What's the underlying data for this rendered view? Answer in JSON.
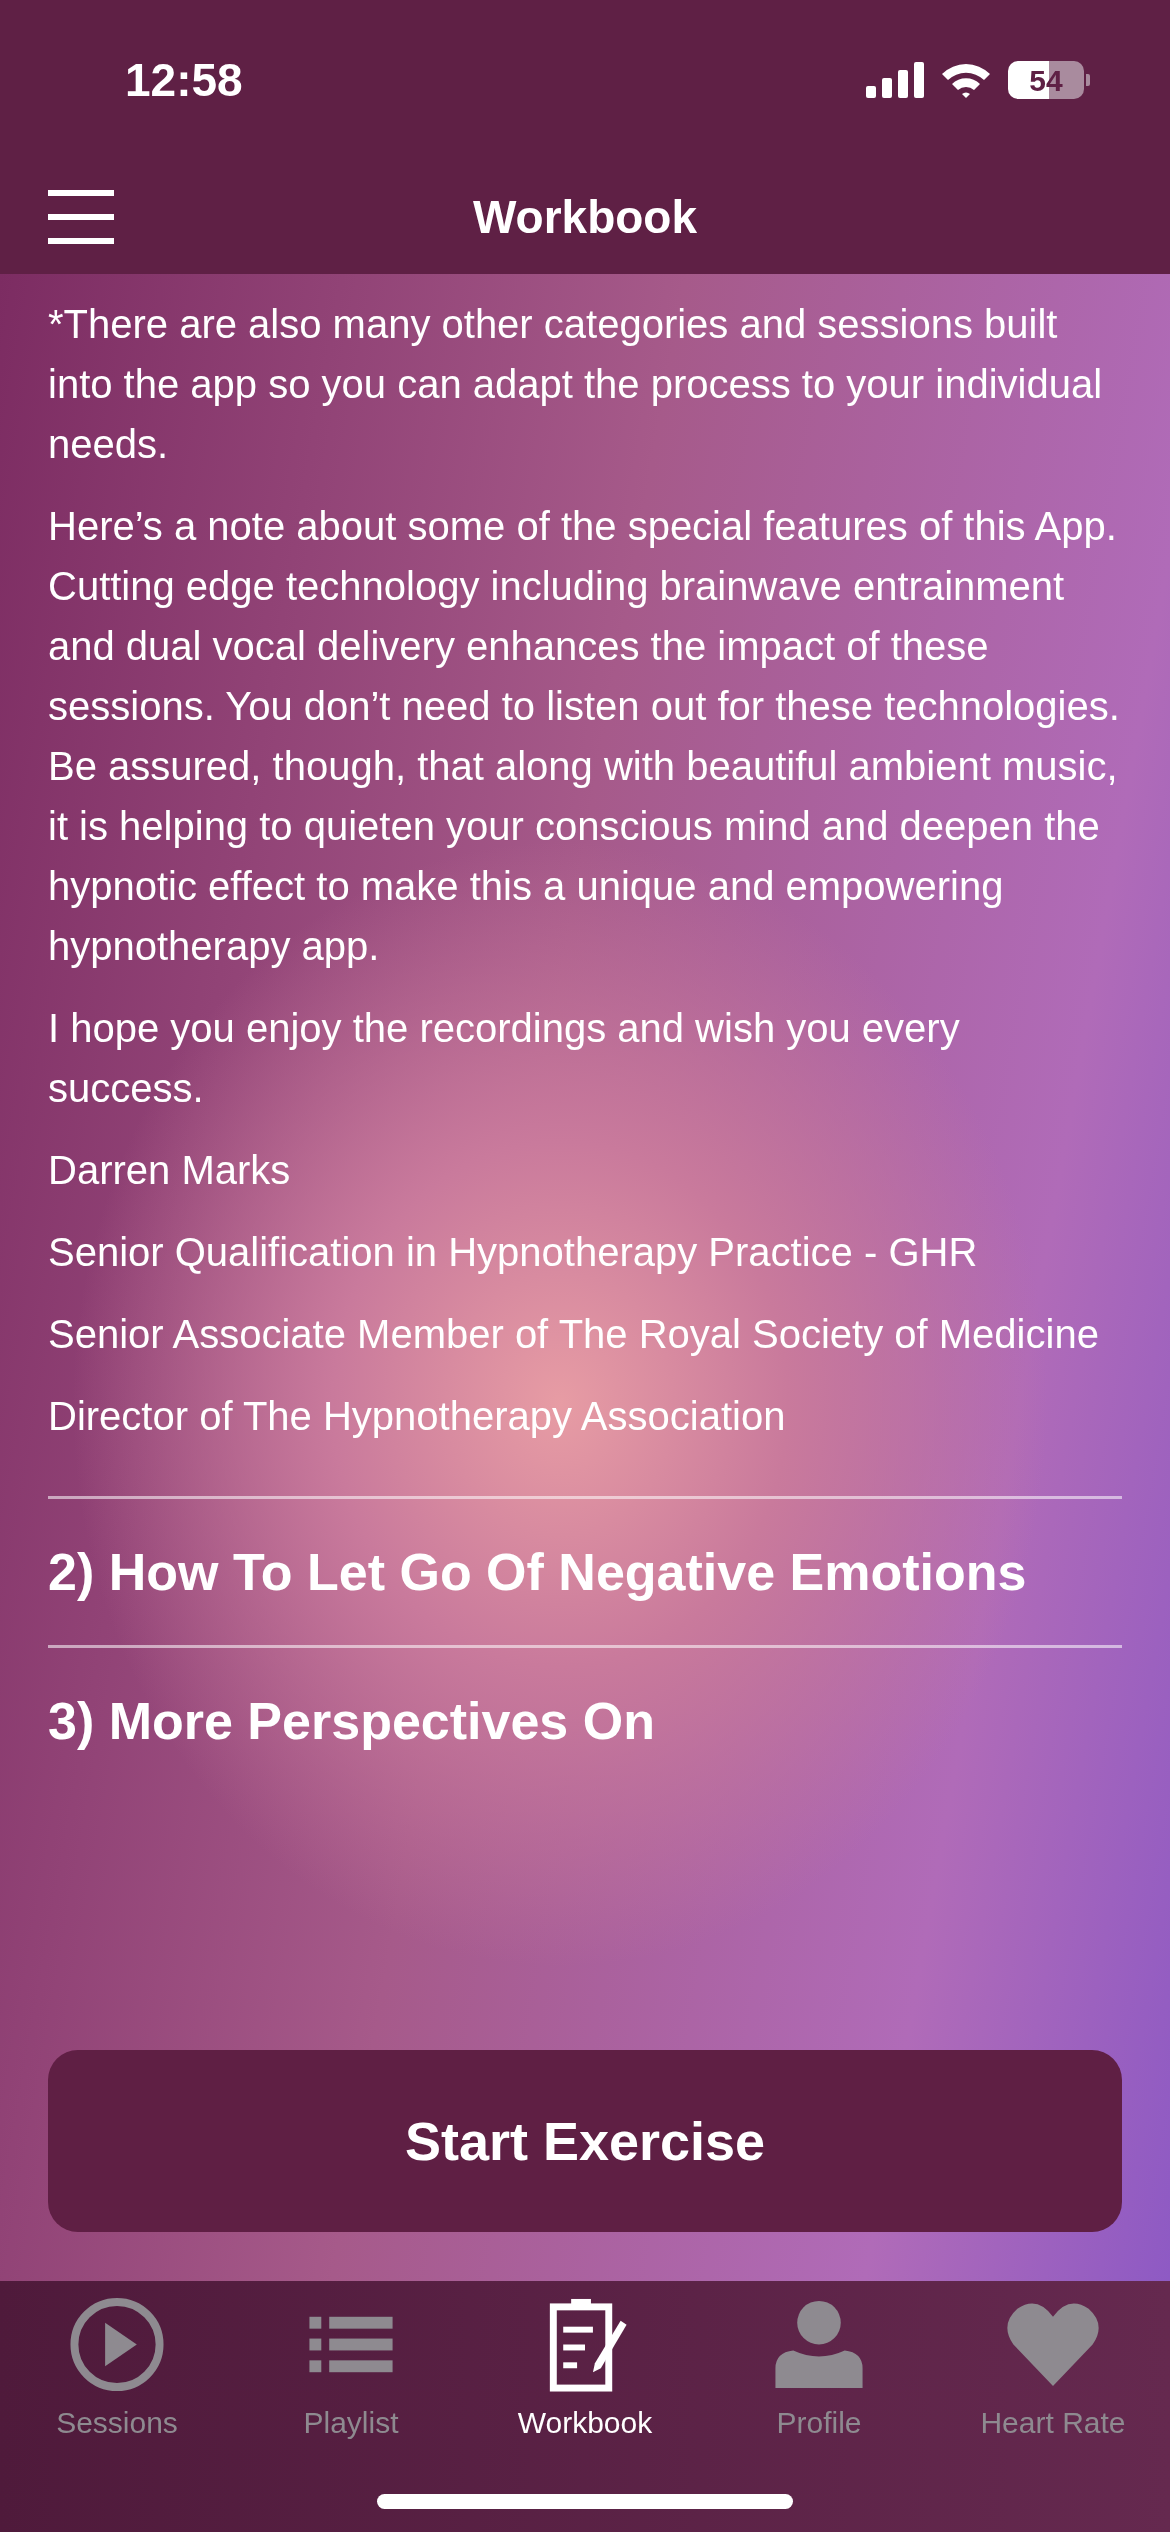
{
  "status_bar": {
    "time": "12:58",
    "battery": "54"
  },
  "header": {
    "title": "Workbook"
  },
  "paragraphs": [
    "*There are also many other categories and sessions built into the app so you can adapt the process to your individual needs.",
    "Here’s a note about some of the special features of this App. Cutting edge technology including brainwave entrainment and dual vocal delivery enhances the impact of these sessions. You don’t need to listen out for these technologies. Be assured, though, that along with beautiful ambient music, it is helping to quieten your conscious mind and deepen the hypnotic effect to make this a unique and empowering hypnotherapy app.",
    "I hope you enjoy the recordings and wish you every success.",
    "Darren Marks",
    "Senior Qualification in Hypnotherapy Practice - GHR",
    "Senior Associate Member of The Royal Society of Medicine",
    "Director of The Hypnotherapy Association"
  ],
  "sections": [
    "2) How To Let Go Of Negative Emotions",
    "3) More Perspectives On"
  ],
  "start_button": "Start Exercise",
  "tabs": [
    {
      "label": "Sessions",
      "selected": false
    },
    {
      "label": "Playlist",
      "selected": false
    },
    {
      "label": "Workbook",
      "selected": true
    },
    {
      "label": "Profile",
      "selected": false
    },
    {
      "label": "Heart Rate",
      "selected": false
    }
  ]
}
